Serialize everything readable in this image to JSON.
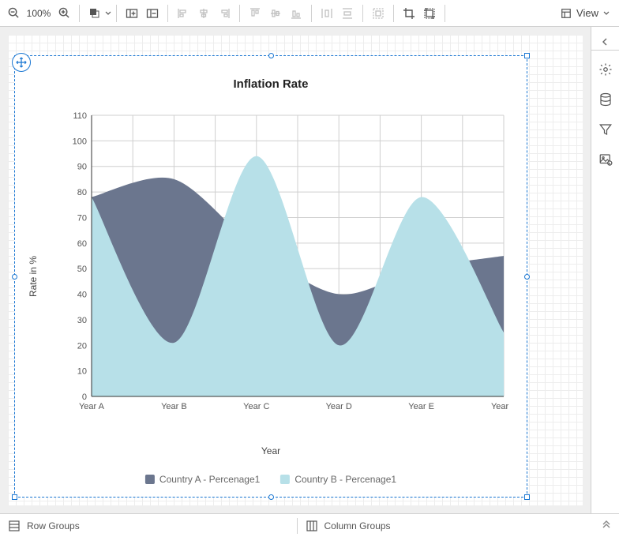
{
  "toolbar": {
    "zoom": "100%",
    "view_label": "View"
  },
  "side_icons": [
    "gear-icon",
    "database-icon",
    "filter-icon",
    "image-icon"
  ],
  "bottom": {
    "row_groups": "Row Groups",
    "column_groups": "Column Groups"
  },
  "chart_data": {
    "type": "area",
    "title": "Inflation Rate",
    "xlabel": "Year",
    "ylabel": "Rate in %",
    "ylim": [
      0,
      110
    ],
    "yticks": [
      0,
      10,
      20,
      30,
      40,
      50,
      60,
      70,
      80,
      90,
      100,
      110
    ],
    "categories": [
      "Year A",
      "Year B",
      "Year C",
      "Year D",
      "Year E",
      "Year F"
    ],
    "series": [
      {
        "name": "Country A - Percenage1",
        "color": "#6b768e",
        "values": [
          78,
          85,
          58,
          40,
          50,
          55
        ]
      },
      {
        "name": "Country B - Percenage1",
        "color": "#b7e0e8",
        "values": [
          78,
          21,
          94,
          20,
          78,
          25
        ]
      }
    ]
  }
}
